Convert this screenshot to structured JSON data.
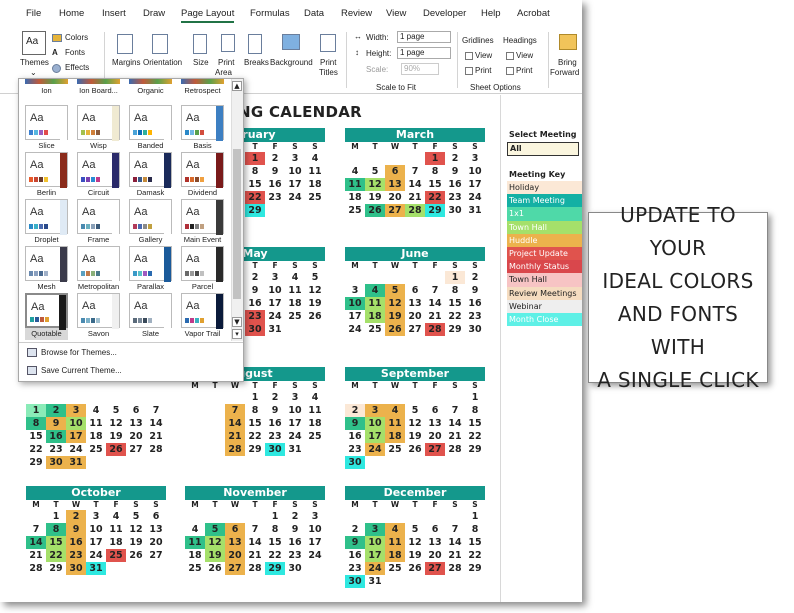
{
  "menu": [
    "File",
    "Home",
    "Insert",
    "Draw",
    "Page Layout",
    "Formulas",
    "Data",
    "Review",
    "View",
    "Developer",
    "Help",
    "Acrobat"
  ],
  "ribbon": {
    "themes": {
      "label": "Themes",
      "colors": "Colors",
      "fonts": "Fonts",
      "effects": "Effects"
    },
    "margins": "Margins",
    "orientation": "Orientation",
    "size": "Size",
    "print_area": [
      "Print",
      "Area"
    ],
    "breaks": "Breaks",
    "background": "Background",
    "print_titles": [
      "Print",
      "Titles"
    ],
    "width_label": "Width:",
    "width_value": "1 page",
    "height_label": "Height:",
    "height_value": "1 page",
    "scale_label": "Scale:",
    "scale_value": "90%",
    "group_scale": "Scale to Fit",
    "gridlines": "Gridlines",
    "headings": "Headings",
    "view": "View",
    "print": "Print",
    "group_sheet": "Sheet Options",
    "bring_forward": [
      "Bring",
      "Forward"
    ]
  },
  "title": "NG CALENDAR",
  "dow": [
    "M",
    "T",
    "W",
    "T",
    "F",
    "S",
    "S"
  ],
  "colors": {
    "teal": "#14988c",
    "G": "#2fc08a",
    "Y": "#a5e06a",
    "O": "#ecb24c",
    "R": "#e0534d",
    "C": "#2ee8e0",
    "P": "#fbe8d6",
    "K": "#f7c4c4",
    "M": "#8aebb8"
  },
  "months": [
    {
      "name": "bruary",
      "rows": [
        [
          null,
          null,
          null,
          "1",
          "2",
          "3",
          "4"
        ],
        [
          null,
          null,
          null,
          "8",
          "9",
          "10",
          "11"
        ],
        [
          null,
          null,
          null,
          "15",
          "16",
          "17",
          "18"
        ],
        [
          null,
          null,
          null,
          "22",
          "23",
          "24",
          "25"
        ],
        [
          null,
          null,
          null,
          "29",
          null,
          null,
          null
        ]
      ],
      "hl": [
        null,
        null,
        null,
        "R",
        null,
        null,
        null,
        null,
        null,
        null,
        null,
        null,
        null,
        null,
        null,
        null,
        null,
        null,
        null,
        null,
        null,
        null,
        null,
        null,
        "R",
        null,
        null,
        null,
        null,
        null,
        null,
        "C",
        null,
        null,
        null
      ]
    },
    {
      "name": "March",
      "rows": [
        [
          null,
          null,
          null,
          null,
          "1",
          "2",
          "3"
        ],
        [
          "4",
          "5",
          "6",
          "7",
          "8",
          "9",
          "10"
        ],
        [
          "11",
          "12",
          "13",
          "14",
          "15",
          "16",
          "17"
        ],
        [
          "18",
          "19",
          "20",
          "21",
          "22",
          "23",
          "24"
        ],
        [
          "25",
          "26",
          "27",
          "28",
          "29",
          "30",
          "31"
        ]
      ],
      "hl": [
        null,
        null,
        null,
        null,
        "R",
        null,
        null,
        null,
        null,
        "O",
        null,
        null,
        null,
        null,
        "G",
        "Y",
        "O",
        null,
        null,
        null,
        null,
        null,
        null,
        null,
        null,
        "R",
        null,
        null,
        null,
        "G",
        "O",
        "Y",
        "C",
        null,
        null
      ]
    },
    {
      "name": "May",
      "rows": [
        [
          null,
          null,
          null,
          "2",
          "3",
          "4",
          "5"
        ],
        [
          null,
          null,
          null,
          "9",
          "10",
          "11",
          "12"
        ],
        [
          null,
          null,
          null,
          "16",
          "17",
          "18",
          "19"
        ],
        [
          null,
          null,
          null,
          "23",
          "24",
          "25",
          "26"
        ],
        [
          null,
          null,
          null,
          "30",
          "31",
          null,
          null
        ]
      ],
      "hl": [
        null,
        null,
        null,
        null,
        null,
        null,
        null,
        null,
        null,
        null,
        null,
        null,
        null,
        null,
        null,
        null,
        null,
        null,
        null,
        null,
        null,
        null,
        null,
        null,
        "R",
        null,
        null,
        null,
        null,
        null,
        null,
        "R",
        null,
        null,
        null
      ]
    },
    {
      "name": "June",
      "rows": [
        [
          null,
          null,
          null,
          null,
          null,
          "1",
          "2"
        ],
        [
          "3",
          "4",
          "5",
          "6",
          "7",
          "8",
          "9"
        ],
        [
          "10",
          "11",
          "12",
          "13",
          "14",
          "15",
          "16"
        ],
        [
          "17",
          "18",
          "19",
          "20",
          "21",
          "22",
          "23"
        ],
        [
          "24",
          "25",
          "26",
          "27",
          "28",
          "29",
          "30"
        ]
      ],
      "hl": [
        null,
        null,
        null,
        null,
        null,
        "P",
        null,
        null,
        "G",
        "O",
        null,
        null,
        null,
        null,
        "G",
        "Y",
        "O",
        null,
        null,
        null,
        null,
        null,
        "Y",
        "O",
        null,
        null,
        null,
        null,
        null,
        null,
        "O",
        null,
        "R",
        null,
        null
      ]
    },
    {
      "name": "ugust",
      "rows": [
        [
          null,
          null,
          null,
          "1",
          "2",
          "3",
          "4"
        ],
        [
          null,
          null,
          "7",
          "8",
          "9",
          "10",
          "11"
        ],
        [
          null,
          null,
          "14",
          "15",
          "16",
          "17",
          "18"
        ],
        [
          null,
          null,
          "21",
          "22",
          "23",
          "24",
          "25"
        ],
        [
          null,
          null,
          "28",
          "29",
          "30",
          "31",
          null
        ]
      ],
      "hl": [
        null,
        null,
        null,
        null,
        null,
        null,
        null,
        null,
        null,
        "O",
        null,
        null,
        null,
        null,
        "G",
        "G",
        "O",
        null,
        null,
        null,
        null,
        null,
        null,
        "O",
        null,
        null,
        null,
        null,
        null,
        "G",
        "O",
        null,
        "C",
        null,
        null
      ]
    },
    {
      "name": "September",
      "rows": [
        [
          null,
          null,
          null,
          null,
          null,
          null,
          "1"
        ],
        [
          "2",
          "3",
          "4",
          "5",
          "6",
          "7",
          "8"
        ],
        [
          "9",
          "10",
          "11",
          "12",
          "13",
          "14",
          "15"
        ],
        [
          "16",
          "17",
          "18",
          "19",
          "20",
          "21",
          "22"
        ],
        [
          "23",
          "24",
          "25",
          "26",
          "27",
          "28",
          "29"
        ],
        [
          "30",
          null,
          null,
          null,
          null,
          null,
          null
        ]
      ],
      "hl": [
        null,
        null,
        null,
        null,
        null,
        null,
        null,
        "P",
        "O",
        "O",
        null,
        null,
        null,
        null,
        "G",
        "Y",
        "O",
        null,
        null,
        null,
        null,
        null,
        "Y",
        "O",
        null,
        null,
        null,
        null,
        null,
        "O",
        null,
        null,
        "R",
        null,
        null,
        "C",
        null,
        null,
        null,
        null,
        null,
        null
      ]
    },
    {
      "name": "October",
      "rows": [
        [
          null,
          "1",
          "2",
          "3",
          "4",
          "5",
          "6"
        ],
        [
          "7",
          "8",
          "9",
          "10",
          "11",
          "12",
          "13"
        ],
        [
          "14",
          "15",
          "16",
          "17",
          "18",
          "19",
          "20"
        ],
        [
          "21",
          "22",
          "23",
          "24",
          "25",
          "26",
          "27"
        ],
        [
          "28",
          "29",
          "30",
          "31",
          null,
          null,
          null
        ]
      ],
      "hl": [
        null,
        null,
        "O",
        null,
        null,
        null,
        null,
        null,
        "G",
        "O",
        null,
        null,
        null,
        null,
        "G",
        "Y",
        "O",
        null,
        null,
        null,
        null,
        null,
        "Y",
        "O",
        null,
        "R",
        null,
        null,
        null,
        null,
        "O",
        "C",
        null,
        null,
        null
      ]
    },
    {
      "name": "November",
      "rows": [
        [
          null,
          null,
          null,
          null,
          "1",
          "2",
          "3"
        ],
        [
          "4",
          "5",
          "6",
          "7",
          "8",
          "9",
          "10"
        ],
        [
          "11",
          "12",
          "13",
          "14",
          "15",
          "16",
          "17"
        ],
        [
          "18",
          "19",
          "20",
          "21",
          "22",
          "23",
          "24"
        ],
        [
          "25",
          "26",
          "27",
          "28",
          "29",
          "30",
          null
        ]
      ],
      "hl": [
        null,
        null,
        null,
        null,
        null,
        null,
        null,
        null,
        "G",
        "O",
        null,
        null,
        null,
        null,
        "G",
        "Y",
        "O",
        null,
        null,
        null,
        null,
        null,
        "Y",
        "O",
        null,
        null,
        null,
        null,
        null,
        null,
        "O",
        null,
        "C",
        null,
        null
      ]
    },
    {
      "name": "December",
      "rows": [
        [
          null,
          null,
          null,
          null,
          null,
          null,
          "1"
        ],
        [
          "2",
          "3",
          "4",
          "5",
          "6",
          "7",
          "8"
        ],
        [
          "9",
          "10",
          "11",
          "12",
          "13",
          "14",
          "15"
        ],
        [
          "16",
          "17",
          "18",
          "19",
          "20",
          "21",
          "22"
        ],
        [
          "23",
          "24",
          "25",
          "26",
          "27",
          "28",
          "29"
        ],
        [
          "30",
          "31",
          null,
          null,
          null,
          null,
          null
        ]
      ],
      "hl": [
        null,
        null,
        null,
        null,
        null,
        null,
        null,
        null,
        "G",
        "O",
        null,
        null,
        null,
        null,
        "G",
        "Y",
        "O",
        null,
        null,
        null,
        null,
        null,
        "Y",
        "O",
        null,
        null,
        null,
        null,
        null,
        "O",
        null,
        null,
        "R",
        null,
        null,
        "C",
        null,
        null,
        null,
        null,
        null,
        null
      ]
    },
    {
      "name": "",
      "rows": [
        [
          null,
          null,
          null,
          null,
          null,
          null,
          null
        ],
        [
          "1",
          "2",
          "3",
          "4",
          "5",
          "6",
          "7"
        ],
        [
          "8",
          "9",
          "10",
          "11",
          "12",
          "13",
          "14"
        ],
        [
          "15",
          "16",
          "17",
          "18",
          "19",
          "20",
          "21"
        ],
        [
          "22",
          "23",
          "24",
          "25",
          "26",
          "27",
          "28"
        ],
        [
          "29",
          "30",
          "31",
          null,
          null,
          null,
          null
        ]
      ],
      "hl": [
        null,
        null,
        null,
        null,
        null,
        null,
        null,
        "M",
        "G",
        "O",
        null,
        null,
        null,
        null,
        "G",
        "O",
        "Y",
        null,
        null,
        null,
        null,
        null,
        "G",
        "O",
        null,
        null,
        null,
        null,
        null,
        null,
        null,
        null,
        "R",
        null,
        null,
        null,
        "O",
        "O",
        null,
        null,
        null,
        null
      ]
    }
  ],
  "select_meeting": {
    "label": "Select Meeting",
    "value": "All"
  },
  "meeting_key": {
    "label": "Meeting Key",
    "items": [
      {
        "name": "Holiday",
        "color": "#fbe8d6"
      },
      {
        "name": "Team Meeting",
        "color": "#14b0a4"
      },
      {
        "name": "1x1",
        "color": "#4fd9a8"
      },
      {
        "name": "Town Hall",
        "color": "#a5e06a"
      },
      {
        "name": "Huddle",
        "color": "#ecb24c"
      },
      {
        "name": "Project Update",
        "color": "#e0534d"
      },
      {
        "name": "Monthly Status",
        "color": "#d9474c"
      },
      {
        "name": "Town Hall",
        "color": "#f7c4c4"
      },
      {
        "name": "Review Meetings",
        "color": "#f5dcc0"
      },
      {
        "name": "Webinar",
        "color": "#eeeeee"
      },
      {
        "name": "Month Close",
        "color": "#5ef0e6"
      }
    ]
  },
  "themes_gallery": {
    "top_labels": [
      "Ion",
      "Ion Board...",
      "Organic",
      "Retrospect"
    ],
    "tiles": [
      {
        "name": "Slice",
        "c": [
          "#3b7fd0",
          "#57b6e0",
          "#9b5fc0",
          "#e24c4c"
        ],
        "s": "#ffffff"
      },
      {
        "name": "Wisp",
        "c": [
          "#a4c04e",
          "#e6b43a",
          "#d0803a",
          "#8a5a3c"
        ],
        "s": "#f0ead2"
      },
      {
        "name": "Banded",
        "c": [
          "#4aa3d8",
          "#0b6cb8",
          "#2fb09c",
          "#ffb400"
        ],
        "s": "#ffffff"
      },
      {
        "name": "Basis",
        "c": [
          "#2a88c8",
          "#72b8e6",
          "#59a04b",
          "#d24d3d"
        ],
        "s": "#3d7fc2"
      },
      {
        "name": "Berlin",
        "c": [
          "#e95a2a",
          "#c74632",
          "#6a3a2a",
          "#f2c230"
        ],
        "s": "#8a2b1b"
      },
      {
        "name": "Circuit",
        "c": [
          "#3b4fc0",
          "#7a3fb0",
          "#2a8ad4",
          "#c03a8a"
        ],
        "s": "#2a2a6a"
      },
      {
        "name": "Damask",
        "c": [
          "#8a1e3a",
          "#3a5a8a",
          "#c48a3a",
          "#2a2a4a"
        ],
        "s": "#1a2a5a"
      },
      {
        "name": "Dividend",
        "c": [
          "#b0322a",
          "#d96a2a",
          "#8a4a2a",
          "#f0a040"
        ],
        "s": "#7a1a1a"
      },
      {
        "name": "Droplet",
        "c": [
          "#2a8ac8",
          "#3ab0c8",
          "#4a6ab0",
          "#2a4a8a"
        ],
        "s": "#dfeaf5"
      },
      {
        "name": "Frame",
        "c": [
          "#4a8ab0",
          "#6ab0c0",
          "#8aa0b8",
          "#3a5a7a"
        ],
        "s": "#ffffff"
      },
      {
        "name": "Gallery",
        "c": [
          "#b23a5a",
          "#4a6ab0",
          "#8a8a8a",
          "#c0a040"
        ],
        "s": "#ffffff"
      },
      {
        "name": "Main Event",
        "c": [
          "#b0303a",
          "#202020",
          "#808080",
          "#c0a080"
        ],
        "s": "#3a3a3a"
      },
      {
        "name": "Mesh",
        "c": [
          "#6a8ab0",
          "#8aa0c0",
          "#4a6a90",
          "#a0b0c8"
        ],
        "s": "#3a3a4a"
      },
      {
        "name": "Metropolitan",
        "c": [
          "#5aa0c0",
          "#c07a4a",
          "#8ab07a",
          "#4a7a8a"
        ],
        "s": "#ffffff"
      },
      {
        "name": "Parallax",
        "c": [
          "#3a9ac8",
          "#5ac0c8",
          "#a05ac0",
          "#2a6ab0"
        ],
        "s": "#1a5a9a"
      },
      {
        "name": "Parcel",
        "c": [
          "#6a6a6a",
          "#9a9a9a",
          "#4a4a4a",
          "#c0c0c0"
        ],
        "s": "#2a2a2a"
      },
      {
        "name": "Quotable",
        "c": [
          "#20a0a0",
          "#2a5a9a",
          "#c05a3a",
          "#e0a030"
        ],
        "s": "#1a1a1a"
      },
      {
        "name": "Savon",
        "c": [
          "#4a8ab0",
          "#7ab0c8",
          "#3a6a8a",
          "#a0c0d0"
        ],
        "s": "#f0f0f0"
      },
      {
        "name": "Slate",
        "c": [
          "#5a6a7a",
          "#7a8a9a",
          "#3a4a5a",
          "#a0b0c0"
        ],
        "s": "#ffffff"
      },
      {
        "name": "Vapor Trail",
        "c": [
          "#2a6ab0",
          "#c03a8a",
          "#3ab0c0",
          "#e0a030"
        ],
        "s": "#0a1a3a"
      }
    ],
    "browse": "Browse for Themes...",
    "save": "Save Current Theme..."
  },
  "callout": [
    "UPDATE TO YOUR",
    "IDEAL COLORS",
    "AND FONTS WITH",
    "A SINGLE CLICK"
  ]
}
